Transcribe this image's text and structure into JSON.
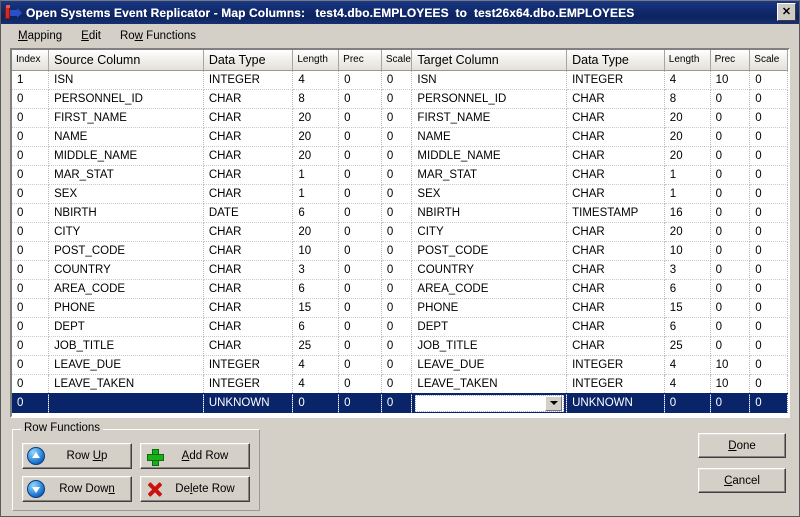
{
  "window": {
    "title": "Open Systems Event Replicator - Map Columns:   test4.dbo.EMPLOYEES  to  test26x64.dbo.EMPLOYEES",
    "app_icon": "replicator-icon",
    "close_label": "✕"
  },
  "menubar": {
    "items": [
      {
        "label": "Mapping",
        "mnemonic": "M"
      },
      {
        "label": "Edit",
        "mnemonic": "E"
      },
      {
        "label": "Row Functions",
        "mnemonic": "w"
      }
    ]
  },
  "grid": {
    "headers": [
      "Index",
      "Source Column",
      "Data Type",
      "Length",
      "Prec",
      "Scale",
      "Target Column",
      "Data Type",
      "Length",
      "Prec",
      "Scale"
    ],
    "rows": [
      {
        "index": "1",
        "src_col": "ISN",
        "src_type": "INTEGER",
        "src_len": "4",
        "src_prec": "0",
        "src_scale": "0",
        "tgt_col": "ISN",
        "tgt_type": "INTEGER",
        "tgt_len": "4",
        "tgt_prec": "10",
        "tgt_scale": "0",
        "selected": false
      },
      {
        "index": "0",
        "src_col": "PERSONNEL_ID",
        "src_type": "CHAR",
        "src_len": "8",
        "src_prec": "0",
        "src_scale": "0",
        "tgt_col": "PERSONNEL_ID",
        "tgt_type": "CHAR",
        "tgt_len": "8",
        "tgt_prec": "0",
        "tgt_scale": "0",
        "selected": false
      },
      {
        "index": "0",
        "src_col": "FIRST_NAME",
        "src_type": "CHAR",
        "src_len": "20",
        "src_prec": "0",
        "src_scale": "0",
        "tgt_col": "FIRST_NAME",
        "tgt_type": "CHAR",
        "tgt_len": "20",
        "tgt_prec": "0",
        "tgt_scale": "0",
        "selected": false
      },
      {
        "index": "0",
        "src_col": "NAME",
        "src_type": "CHAR",
        "src_len": "20",
        "src_prec": "0",
        "src_scale": "0",
        "tgt_col": "NAME",
        "tgt_type": "CHAR",
        "tgt_len": "20",
        "tgt_prec": "0",
        "tgt_scale": "0",
        "selected": false
      },
      {
        "index": "0",
        "src_col": "MIDDLE_NAME",
        "src_type": "CHAR",
        "src_len": "20",
        "src_prec": "0",
        "src_scale": "0",
        "tgt_col": "MIDDLE_NAME",
        "tgt_type": "CHAR",
        "tgt_len": "20",
        "tgt_prec": "0",
        "tgt_scale": "0",
        "selected": false
      },
      {
        "index": "0",
        "src_col": "MAR_STAT",
        "src_type": "CHAR",
        "src_len": "1",
        "src_prec": "0",
        "src_scale": "0",
        "tgt_col": "MAR_STAT",
        "tgt_type": "CHAR",
        "tgt_len": "1",
        "tgt_prec": "0",
        "tgt_scale": "0",
        "selected": false
      },
      {
        "index": "0",
        "src_col": "SEX",
        "src_type": "CHAR",
        "src_len": "1",
        "src_prec": "0",
        "src_scale": "0",
        "tgt_col": "SEX",
        "tgt_type": "CHAR",
        "tgt_len": "1",
        "tgt_prec": "0",
        "tgt_scale": "0",
        "selected": false
      },
      {
        "index": "0",
        "src_col": "NBIRTH",
        "src_type": "DATE",
        "src_len": "6",
        "src_prec": "0",
        "src_scale": "0",
        "tgt_col": "NBIRTH",
        "tgt_type": "TIMESTAMP",
        "tgt_len": "16",
        "tgt_prec": "0",
        "tgt_scale": "0",
        "selected": false
      },
      {
        "index": "0",
        "src_col": "CITY",
        "src_type": "CHAR",
        "src_len": "20",
        "src_prec": "0",
        "src_scale": "0",
        "tgt_col": "CITY",
        "tgt_type": "CHAR",
        "tgt_len": "20",
        "tgt_prec": "0",
        "tgt_scale": "0",
        "selected": false
      },
      {
        "index": "0",
        "src_col": "POST_CODE",
        "src_type": "CHAR",
        "src_len": "10",
        "src_prec": "0",
        "src_scale": "0",
        "tgt_col": "POST_CODE",
        "tgt_type": "CHAR",
        "tgt_len": "10",
        "tgt_prec": "0",
        "tgt_scale": "0",
        "selected": false
      },
      {
        "index": "0",
        "src_col": "COUNTRY",
        "src_type": "CHAR",
        "src_len": "3",
        "src_prec": "0",
        "src_scale": "0",
        "tgt_col": "COUNTRY",
        "tgt_type": "CHAR",
        "tgt_len": "3",
        "tgt_prec": "0",
        "tgt_scale": "0",
        "selected": false
      },
      {
        "index": "0",
        "src_col": "AREA_CODE",
        "src_type": "CHAR",
        "src_len": "6",
        "src_prec": "0",
        "src_scale": "0",
        "tgt_col": "AREA_CODE",
        "tgt_type": "CHAR",
        "tgt_len": "6",
        "tgt_prec": "0",
        "tgt_scale": "0",
        "selected": false
      },
      {
        "index": "0",
        "src_col": "PHONE",
        "src_type": "CHAR",
        "src_len": "15",
        "src_prec": "0",
        "src_scale": "0",
        "tgt_col": "PHONE",
        "tgt_type": "CHAR",
        "tgt_len": "15",
        "tgt_prec": "0",
        "tgt_scale": "0",
        "selected": false
      },
      {
        "index": "0",
        "src_col": "DEPT",
        "src_type": "CHAR",
        "src_len": "6",
        "src_prec": "0",
        "src_scale": "0",
        "tgt_col": "DEPT",
        "tgt_type": "CHAR",
        "tgt_len": "6",
        "tgt_prec": "0",
        "tgt_scale": "0",
        "selected": false
      },
      {
        "index": "0",
        "src_col": "JOB_TITLE",
        "src_type": "CHAR",
        "src_len": "25",
        "src_prec": "0",
        "src_scale": "0",
        "tgt_col": "JOB_TITLE",
        "tgt_type": "CHAR",
        "tgt_len": "25",
        "tgt_prec": "0",
        "tgt_scale": "0",
        "selected": false
      },
      {
        "index": "0",
        "src_col": "LEAVE_DUE",
        "src_type": "INTEGER",
        "src_len": "4",
        "src_prec": "0",
        "src_scale": "0",
        "tgt_col": "LEAVE_DUE",
        "tgt_type": "INTEGER",
        "tgt_len": "4",
        "tgt_prec": "10",
        "tgt_scale": "0",
        "selected": false
      },
      {
        "index": "0",
        "src_col": "LEAVE_TAKEN",
        "src_type": "INTEGER",
        "src_len": "4",
        "src_prec": "0",
        "src_scale": "0",
        "tgt_col": "LEAVE_TAKEN",
        "tgt_type": "INTEGER",
        "tgt_len": "4",
        "tgt_prec": "10",
        "tgt_scale": "0",
        "selected": false
      },
      {
        "index": "0",
        "src_col": "",
        "src_type": "UNKNOWN",
        "src_len": "0",
        "src_prec": "0",
        "src_scale": "0",
        "tgt_col": "",
        "tgt_type": "UNKNOWN",
        "tgt_len": "0",
        "tgt_prec": "0",
        "tgt_scale": "0",
        "selected": true
      }
    ]
  },
  "row_functions": {
    "group_title": "Row Functions",
    "buttons": [
      {
        "id": "row-up",
        "label": "Row Up",
        "icon": "arrow-up-circle-icon"
      },
      {
        "id": "row-down",
        "label": "Row Down",
        "icon": "arrow-down-circle-icon"
      },
      {
        "id": "add-row",
        "label": "Add Row",
        "icon": "plus-icon"
      },
      {
        "id": "delete-row",
        "label": "Delete Row",
        "icon": "x-delete-icon"
      }
    ]
  },
  "dialog_buttons": {
    "done": "Done",
    "cancel": "Cancel"
  },
  "colors": {
    "titlebar": "#0e2461",
    "selection": "#0a246a",
    "face": "#d4d0c8",
    "grid_bg": "#ffffff",
    "add_icon": "#18b018",
    "delete_icon": "#cc1111",
    "nav_icon": "#1463c4"
  }
}
